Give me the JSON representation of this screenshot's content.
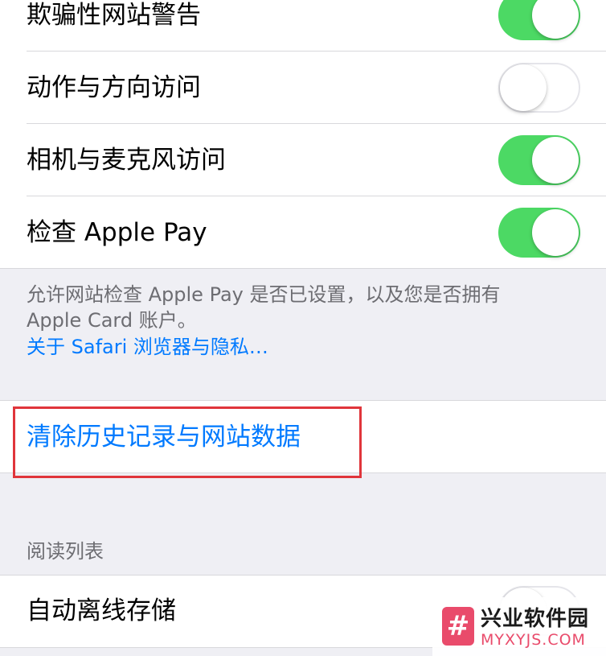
{
  "privacy_security": {
    "rows": [
      {
        "label": "欺骗性网站警告",
        "enabled": true
      },
      {
        "label": "动作与方向访问",
        "enabled": false
      },
      {
        "label": "相机与麦克风访问",
        "enabled": true
      },
      {
        "label": "检查 Apple Pay",
        "enabled": true
      }
    ],
    "footer_line1": "允许网站检查 Apple Pay 是否已设置，以及您是否拥有",
    "footer_line2": "Apple Card 账户。",
    "footer_link": "关于 Safari 浏览器与隐私…"
  },
  "clear_history": {
    "label": "清除历史记录与网站数据"
  },
  "reading_list": {
    "header": "阅读列表",
    "rows": [
      {
        "label": "自动离线存储",
        "enabled": false
      }
    ]
  },
  "watermark": {
    "logo_glyph": "#",
    "title": "兴业软件园",
    "subtitle": "MYXYJS.COM"
  },
  "colors": {
    "toggle_on": "#4cd964",
    "link_blue": "#007aff",
    "highlight_red": "#e0353b"
  }
}
